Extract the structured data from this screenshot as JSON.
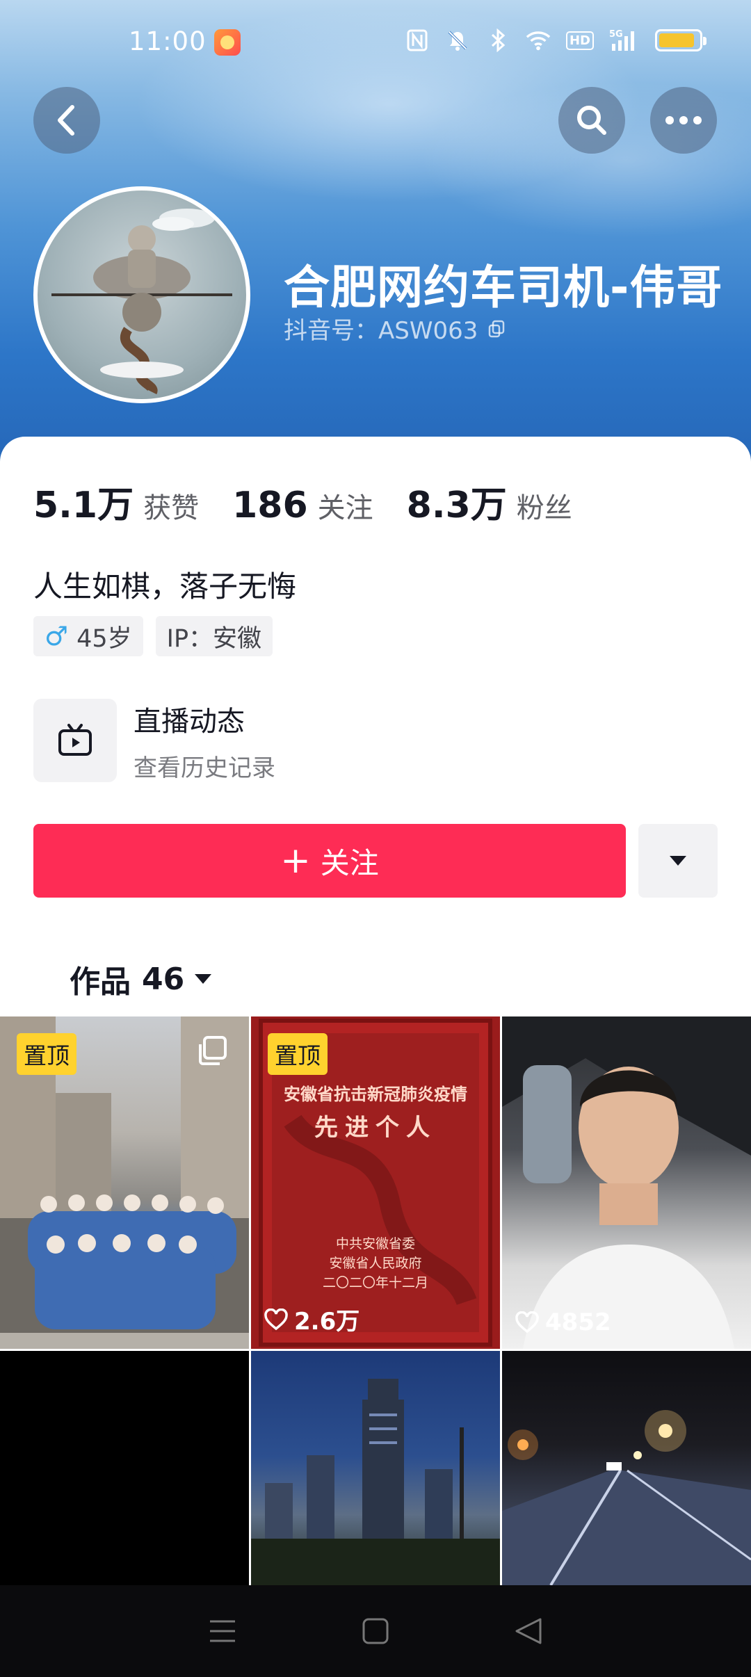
{
  "status_bar": {
    "time": "11:00",
    "network": "5G",
    "hd": "HD",
    "battery_level": 0.9,
    "battery_color": "#f6c42d"
  },
  "header": {
    "nickname": "合肥网约车司机-伟哥",
    "douyin_id_label": "抖音号：ASW063"
  },
  "stats": [
    {
      "value": "5.1万",
      "label": "获赞"
    },
    {
      "value": "186",
      "label": "关注"
    },
    {
      "value": "8.3万",
      "label": "粉丝"
    }
  ],
  "bio": "人生如棋，落子无悔",
  "tags": {
    "gender_symbol": "♂",
    "age": "45岁",
    "ip": "IP：安徽"
  },
  "live": {
    "title": "直播动态",
    "subtitle": "查看历史记录",
    "icon": "tv-icon"
  },
  "actions": {
    "follow_plus": "+",
    "follow_label": "关注",
    "follow_color": "#fe2c55"
  },
  "works": {
    "label": "作品",
    "count": "46"
  },
  "videos": [
    {
      "pin": "置顶",
      "likes": ""
    },
    {
      "pin": "置顶",
      "likes": "2.6万"
    },
    {
      "pin": "",
      "likes": "4852"
    },
    {
      "pin": "",
      "likes": ""
    },
    {
      "pin": "",
      "likes": ""
    },
    {
      "pin": "",
      "likes": ""
    }
  ],
  "video2_text": {
    "title": "安徽省抗击新冠肺炎疫情",
    "subtitle": "先进个人",
    "issuer1": "中共安徽省委",
    "issuer2": "安徽省人民政府",
    "date": "二〇二〇年十二月"
  }
}
